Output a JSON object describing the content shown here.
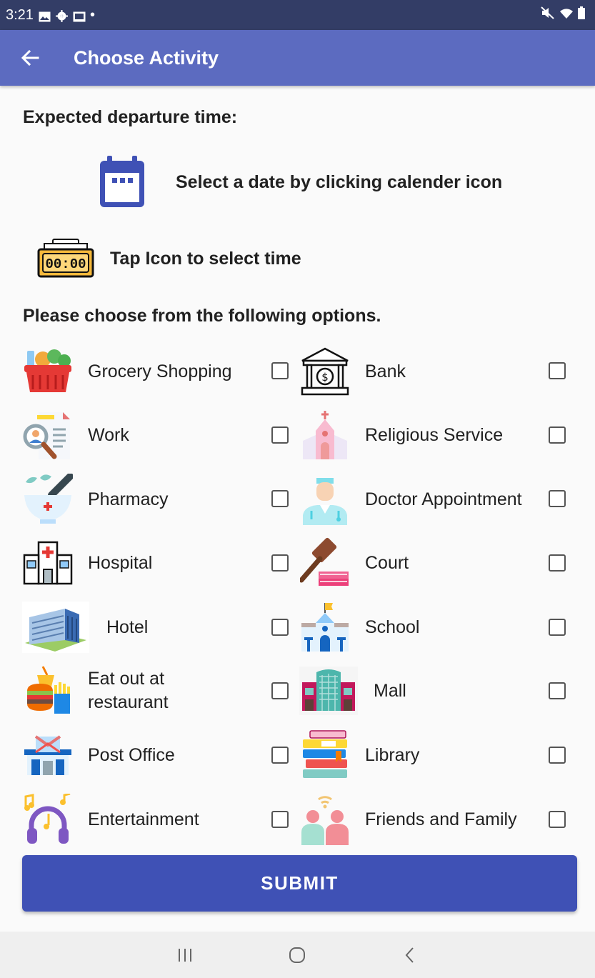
{
  "status_bar": {
    "time": "3:21",
    "dot": "•"
  },
  "app_bar": {
    "title": "Choose Activity",
    "back_icon": "arrow-back-icon"
  },
  "departure": {
    "label": "Expected departure time:",
    "date_hint": "Select a date by clicking calender icon",
    "time_hint": "Tap Icon to select time",
    "clock_text": "00:00"
  },
  "options_label": "Please choose from the following options.",
  "activities": [
    {
      "label": "Grocery Shopping",
      "checked": false
    },
    {
      "label": "Bank",
      "checked": false
    },
    {
      "label": "Work",
      "checked": false
    },
    {
      "label": "Religious Service",
      "checked": false
    },
    {
      "label": "Pharmacy",
      "checked": false
    },
    {
      "label": "Doctor Appointment",
      "checked": false
    },
    {
      "label": "Hospital",
      "checked": false
    },
    {
      "label": "Court",
      "checked": false
    },
    {
      "label": "Hotel",
      "checked": false
    },
    {
      "label": "School",
      "checked": false
    },
    {
      "label": "Eat out at restaurant",
      "checked": false
    },
    {
      "label": "Mall",
      "checked": false
    },
    {
      "label": "Post Office",
      "checked": false
    },
    {
      "label": "Library",
      "checked": false
    },
    {
      "label": "Entertainment",
      "checked": false
    },
    {
      "label": "Friends and Family",
      "checked": false
    }
  ],
  "submit_label": "SUBMIT",
  "colors": {
    "app_bar": "#5c6bc0",
    "status_bar": "#333d66",
    "submit": "#3f51b5"
  }
}
